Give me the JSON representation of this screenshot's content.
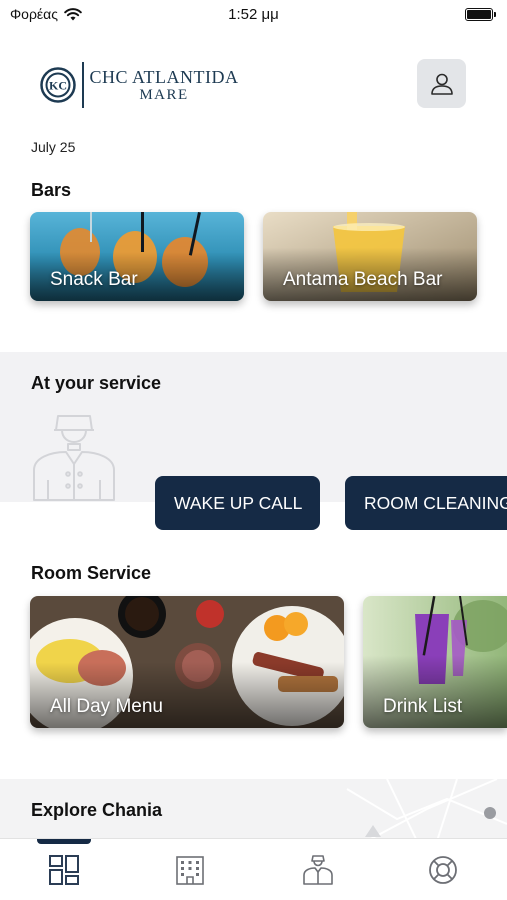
{
  "status_bar": {
    "carrier": "Φορέας",
    "time": "1:52 μμ",
    "battery_level": 1.0
  },
  "header": {
    "logo_line1": "CHC ATLANTIDA",
    "logo_line2": "MARE",
    "logo_mark": "KC"
  },
  "date": "July 25",
  "bars": {
    "title": "Bars",
    "items": [
      {
        "label": "Snack Bar"
      },
      {
        "label": "Antama Beach Bar"
      }
    ]
  },
  "service": {
    "title": "At your service",
    "buttons": [
      {
        "label": "WAKE UP CALL"
      },
      {
        "label": "ROOM CLEANING"
      }
    ]
  },
  "room_service": {
    "title": "Room Service",
    "items": [
      {
        "label": "All Day Menu"
      },
      {
        "label": "Drink List"
      }
    ]
  },
  "explore": {
    "title": "Explore Chania"
  },
  "tabs": [
    {
      "icon": "dashboard-icon",
      "active": true
    },
    {
      "icon": "hotel-building-icon",
      "active": false
    },
    {
      "icon": "concierge-icon",
      "active": false
    },
    {
      "icon": "lifebuoy-icon",
      "active": false
    }
  ],
  "colors": {
    "navy": "#152a45",
    "logo_blue": "#1d3a52",
    "band_gray": "#f2f2f4"
  }
}
